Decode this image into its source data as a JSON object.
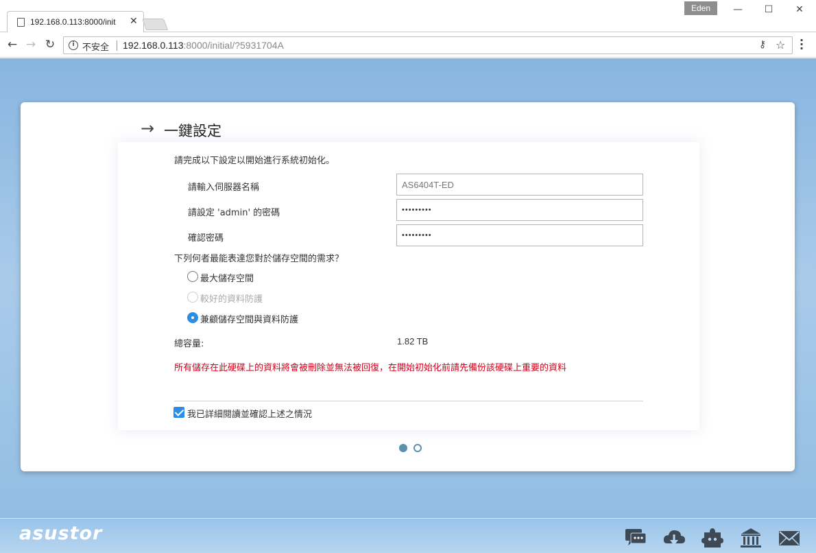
{
  "browser": {
    "tab_title": "192.168.0.113:8000/init",
    "profile_name": "Eden",
    "security_label": "不安全",
    "url_host": "192.168.0.113",
    "url_rest": ":8000/initial/?5931704A"
  },
  "wizard": {
    "title": "一鍵設定",
    "intro": "請完成以下設定以開始進行系統初始化。",
    "fields": [
      {
        "label": "請輸入伺服器名稱",
        "value": "AS6404T-ED"
      },
      {
        "label": "請設定 'admin' 的密碼",
        "value": "•••••••••"
      },
      {
        "label": "確認密碼",
        "value": "•••••••••"
      }
    ],
    "question": "下列何者最能表達您對於儲存空間的需求？",
    "options": [
      {
        "label": "最大儲存空間",
        "state": "unchecked"
      },
      {
        "label": "較好的資料防護",
        "state": "disabled"
      },
      {
        "label": "兼顧儲存空間與資料防護",
        "state": "checked"
      }
    ],
    "capacity_label": "總容量:",
    "capacity_value": "1.82 TB",
    "warning": "所有儲存在此硬碟上的資料將會被刪除並無法被回復，在開始初始化前請先備份該硬碟上重要的資料",
    "confirm_label": "我已詳細閱讀並確認上述之情況",
    "confirm_checked": true,
    "page_indicator": {
      "current": 1,
      "total": 2
    }
  },
  "footer": {
    "logo": "asustor",
    "icons": [
      "chat-icon",
      "cloud-download-icon",
      "puzzle-icon",
      "bank-icon",
      "mail-icon"
    ]
  },
  "colors": {
    "accent": "#2c8ee3",
    "warning": "#d0021b",
    "background": "#a9cbea"
  }
}
